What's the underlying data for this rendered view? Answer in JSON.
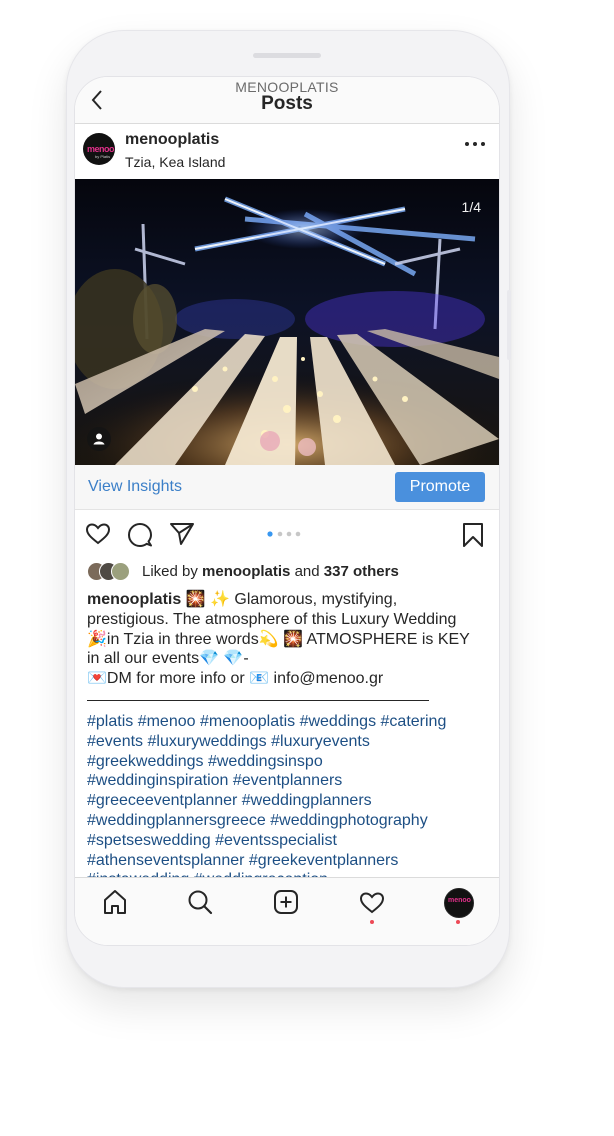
{
  "header": {
    "account": "MENOOPLATIS",
    "title": "Posts"
  },
  "post": {
    "username": "menooplatis",
    "location": "Tzia, Kea Island",
    "avatar_text": "menoo",
    "avatar_subtext": "by Platis",
    "image_counter": "1/4",
    "image_index": 1,
    "image_count": 4
  },
  "insights": {
    "view_label": "View Insights",
    "promote_label": "Promote"
  },
  "likes": {
    "prefix": "Liked by",
    "user": "menooplatis",
    "joiner": "and",
    "others": "337 others"
  },
  "caption": {
    "username": "menooplatis",
    "line1": "🎇 ✨ Glamorous, mystifying,",
    "line2": "prestigious. The atmosphere of this Luxury Wedding",
    "line3": "🎉in Tzia in three words💫 🎇 ATMOSPHERE is KEY",
    "line4": "in all our events💎 💎-",
    "line5": "💌DM for more info or 📧 info@menoo.gr"
  },
  "hashtags": [
    "#platis #menoo #menooplatis #weddings #catering",
    "#events #luxuryweddings #luxuryevents",
    "#greekweddings #weddingsinspo",
    "#weddinginspiration #eventplanners",
    "#greeceeventplanner #weddingplanners",
    "#weddingplannersgreece #weddingphotography",
    "#spetseswedding #eventsspecialist",
    "#athenseventsplanner #greekeventplanners",
    "#instawedding #weddingreception"
  ],
  "nav": {
    "avatar_text": "menoo"
  },
  "colors": {
    "link_blue": "#3b7fc8",
    "promote_blue": "#4a90dd",
    "hashtag_blue": "#1d4f84",
    "notification_red": "#ed4956"
  }
}
